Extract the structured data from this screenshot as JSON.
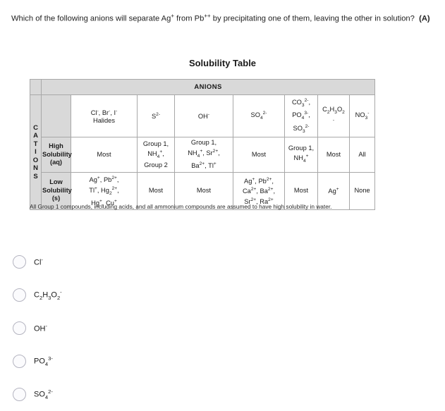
{
  "question": {
    "text_part1": "Which of the following anions will separate Ag",
    "sup1": "+",
    "text_part2": " from Pb",
    "sup2": "++",
    "text_part3": " by precipitating one of them, leaving the other in solution?",
    "tag": "(A)"
  },
  "table": {
    "title": "Solubility Table",
    "anions_header": "ANIONS",
    "cations_spine": "CATIONS",
    "note": "All Group 1 compounds, including acids, and all ammonium compounds are assumed to have high solubility in water.",
    "columns": [
      {
        "id": "halides",
        "line1_a": "Cl",
        "line1_a_sup": "-",
        "line1_b": ", Br",
        "line1_b_sup": "-",
        "line1_c": ", I",
        "line1_c_sup": "-",
        "line2": "Halides"
      },
      {
        "id": "sulfide",
        "base": "S",
        "sup": "2-"
      },
      {
        "id": "hydroxide",
        "base": "OH",
        "sup": "-"
      },
      {
        "id": "sulfate",
        "base": "SO",
        "sub": "4",
        "sup": "2-"
      },
      {
        "id": "carbonate-phosphate-sulfite",
        "l1b": "CO",
        "l1sub": "3",
        "l1sup": "2-",
        "l1tail": ",",
        "l2b": "PO",
        "l2sub": "4",
        "l2sup": "3-",
        "l2tail": ",",
        "l3b": "SO",
        "l3sub": "3",
        "l3sup": "2-"
      },
      {
        "id": "acetate",
        "base": "C",
        "sub1": "2",
        "mid": "H",
        "sub2": "3",
        "mid2": "O",
        "sub3": "2",
        "sup": "-"
      },
      {
        "id": "nitrate",
        "base": "NO",
        "sub": "3",
        "sup": "-"
      }
    ],
    "rows": [
      {
        "id": "high-solubility",
        "label_line1": "High",
        "label_line2": "Solubility",
        "label_line3": "(aq)",
        "cells": [
          {
            "id": "high-halides",
            "text": "Most"
          },
          {
            "id": "high-sulfide",
            "lines": [
              "Group 1,",
              "NH4+,",
              "Group 2"
            ]
          },
          {
            "id": "high-hydroxide",
            "lines": [
              "Group 1,",
              "NH4+, Sr2+,",
              "Ba2+, Tl+"
            ]
          },
          {
            "id": "high-sulfate",
            "text": "Most"
          },
          {
            "id": "high-carbonate",
            "lines": [
              "Group 1,",
              "NH4+"
            ]
          },
          {
            "id": "high-acetate",
            "text": "Most"
          },
          {
            "id": "high-nitrate",
            "text": "All"
          }
        ]
      },
      {
        "id": "low-solubility",
        "label_line1": "Low",
        "label_line2": "Solubility",
        "label_line3": "(s)",
        "cells": [
          {
            "id": "low-halides",
            "lines": [
              "Ag+, Pb2+,",
              "Tl+, Hg22+,",
              "Hg+, Cu+"
            ]
          },
          {
            "id": "low-sulfide",
            "text": "Most"
          },
          {
            "id": "low-hydroxide",
            "text": "Most"
          },
          {
            "id": "low-sulfate",
            "lines": [
              "Ag+, Pb2+,",
              "Ca2+, Ba2+,",
              "Sr2+, Ra2+"
            ]
          },
          {
            "id": "low-carbonate",
            "text": "Most"
          },
          {
            "id": "low-acetate",
            "text": "Ag+"
          },
          {
            "id": "low-nitrate",
            "text": "None"
          }
        ]
      }
    ]
  },
  "options": [
    {
      "id": "chloride",
      "base": "Cl",
      "sub": "",
      "sup": "-"
    },
    {
      "id": "acetate",
      "base": "C",
      "formula": "C2H3O2",
      "sup": "-"
    },
    {
      "id": "hydroxide",
      "base": "OH",
      "sub": "",
      "sup": "-"
    },
    {
      "id": "phosphate",
      "base": "PO",
      "sub": "4",
      "sup": "3-"
    },
    {
      "id": "sulfate",
      "base": "SO",
      "sub": "4",
      "sup": "2-"
    }
  ],
  "colors": {
    "header_bg": "#d9d9d9",
    "border": "#a8a8a8",
    "text": "#1a1a1a",
    "radio_border": "#b4b4c0"
  }
}
